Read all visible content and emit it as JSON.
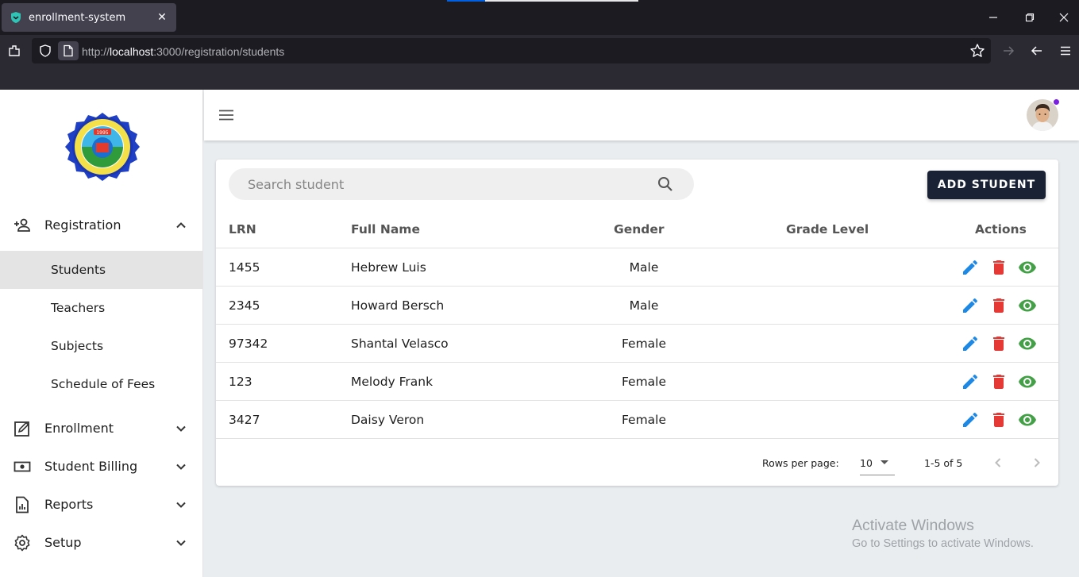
{
  "browser": {
    "tab_title": "enrollment-system",
    "url_prefix": "http://",
    "url_host": "localhost",
    "url_rest": ":3000/registration/students"
  },
  "sidebar": {
    "logo_name": "school-seal-logo",
    "items": [
      {
        "label": "Registration",
        "icon": "person-add-icon",
        "expanded": true,
        "children": [
          {
            "label": "Students",
            "active": true
          },
          {
            "label": "Teachers"
          },
          {
            "label": "Subjects"
          },
          {
            "label": "Schedule of Fees"
          }
        ]
      },
      {
        "label": "Enrollment",
        "icon": "edit-square-icon",
        "expanded": false
      },
      {
        "label": "Student Billing",
        "icon": "money-icon",
        "expanded": false
      },
      {
        "label": "Reports",
        "icon": "chart-report-icon",
        "expanded": false
      },
      {
        "label": "Setup",
        "icon": "gear-icon",
        "expanded": false
      }
    ]
  },
  "toolbar": {
    "search_placeholder": "Search student",
    "add_label": "ADD STUDENT"
  },
  "table": {
    "columns": [
      "LRN",
      "Full Name",
      "Gender",
      "Grade Level",
      "Actions"
    ],
    "rows": [
      {
        "lrn": "1455",
        "name": "Hebrew Luis",
        "gender": "Male",
        "grade": ""
      },
      {
        "lrn": "2345",
        "name": "Howard Bersch",
        "gender": "Male",
        "grade": ""
      },
      {
        "lrn": "97342",
        "name": "Shantal Velasco",
        "gender": "Female",
        "grade": ""
      },
      {
        "lrn": "123",
        "name": "Melody Frank",
        "gender": "Female",
        "grade": ""
      },
      {
        "lrn": "3427",
        "name": "Daisy Veron",
        "gender": "Female",
        "grade": ""
      }
    ]
  },
  "pagination": {
    "rows_per_page_label": "Rows per page:",
    "rows_per_page": "10",
    "range": "1-5 of 5"
  },
  "watermark": {
    "title": "Activate Windows",
    "subtitle": "Go to Settings to activate Windows."
  },
  "colors": {
    "accent_dark": "#1a2236",
    "edit": "#1e88e5",
    "delete": "#e53935",
    "view": "#43a047"
  }
}
